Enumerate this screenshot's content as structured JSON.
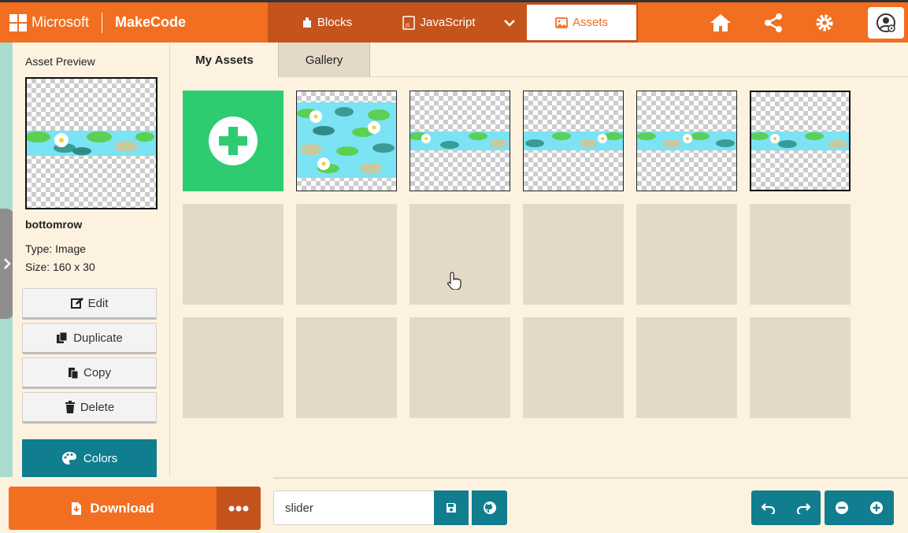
{
  "header": {
    "brand_microsoft": "Microsoft",
    "brand_product": "MakeCode",
    "tabs": [
      {
        "label": "Blocks",
        "icon": "puzzle-icon"
      },
      {
        "label": "JavaScript",
        "icon": "js-file-icon"
      },
      {
        "label": "Assets",
        "icon": "image-icon"
      }
    ],
    "active_tab": "Assets",
    "right_icons": [
      "home-icon",
      "share-icon",
      "gear-icon",
      "user-settings-icon"
    ]
  },
  "sidebar": {
    "preview_label": "Asset Preview",
    "asset_name": "bottomrow",
    "type_text": "Type: Image",
    "size_text": "Size: 160 x 30",
    "buttons": [
      {
        "label": "Edit",
        "icon": "edit-icon"
      },
      {
        "label": "Duplicate",
        "icon": "duplicate-icon"
      },
      {
        "label": "Copy",
        "icon": "copy-icon"
      },
      {
        "label": "Delete",
        "icon": "trash-icon"
      }
    ],
    "colors_label": "Colors"
  },
  "main": {
    "tabs": [
      {
        "label": "My Assets"
      },
      {
        "label": "Gallery"
      }
    ],
    "active_tab": "My Assets"
  },
  "footer": {
    "download_label": "Download",
    "project_name": "slider"
  },
  "colors": {
    "accent_orange": "#f26f21",
    "dark_orange": "#c4531c",
    "teal": "#107e8f",
    "add_green": "#2ecc71",
    "water": "#7be3f3",
    "lily_pad": "#5ccf55"
  }
}
